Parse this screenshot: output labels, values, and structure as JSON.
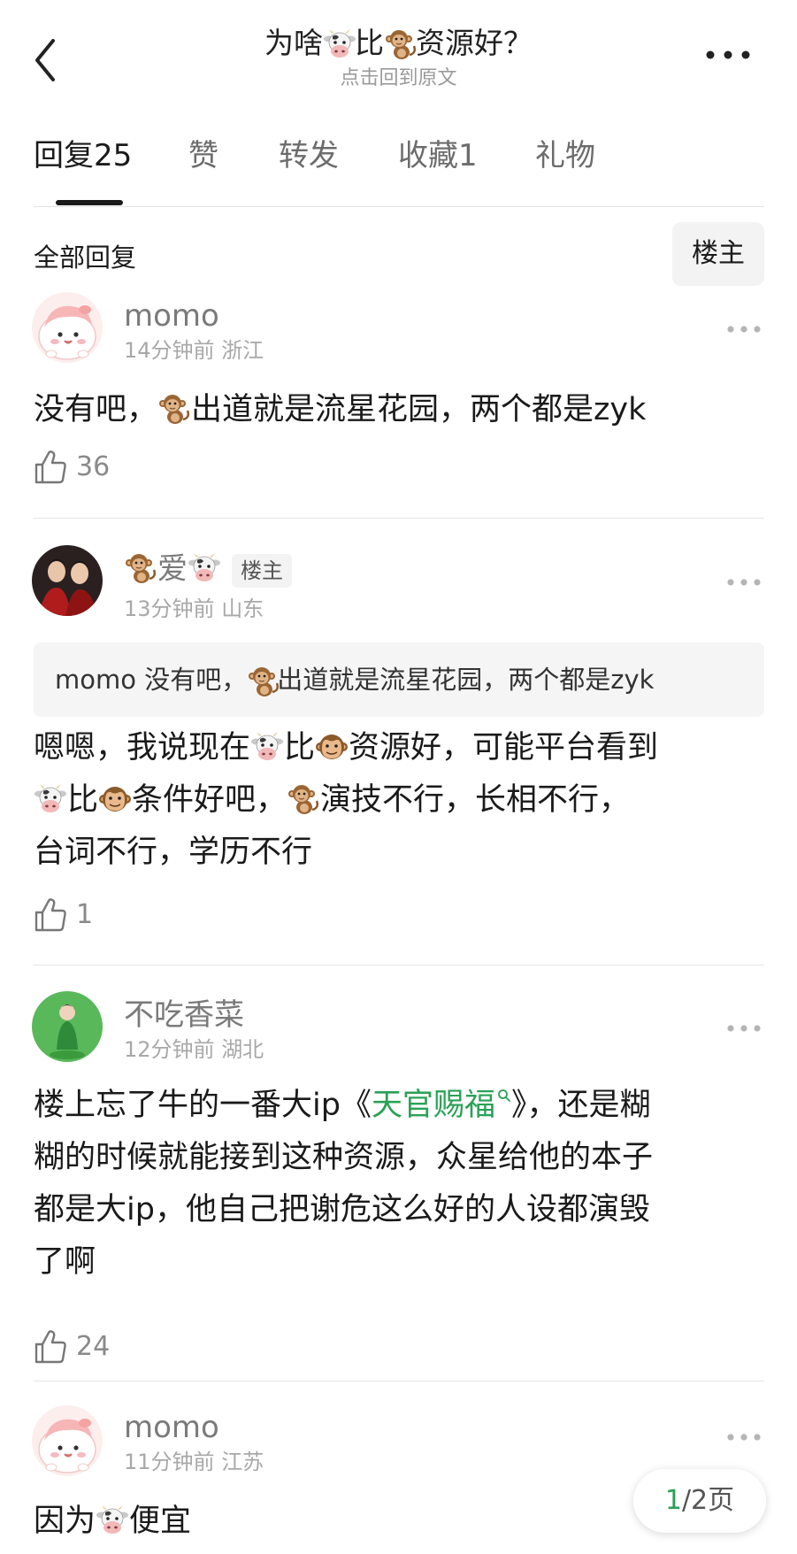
{
  "header": {
    "title_part1": "为啥",
    "title_part2": "比",
    "title_part3": "资源好？",
    "subtitle": "点击回到原文"
  },
  "tabs": [
    {
      "label": "回复",
      "count": "25"
    },
    {
      "label": "赞",
      "count": ""
    },
    {
      "label": "转发",
      "count": ""
    },
    {
      "label": "收藏",
      "count": "1"
    },
    {
      "label": "礼物",
      "count": ""
    }
  ],
  "section": {
    "title": "全部回复",
    "owner_filter": "楼主"
  },
  "comments": [
    {
      "username": "momo",
      "time": "14分钟前",
      "location": "浙江",
      "text_a": "没有吧，",
      "text_b": "出道就是流星花园，两个都是zyk",
      "likes": "36"
    },
    {
      "username_text": "爱",
      "badge": "楼主",
      "time": "13分钟前",
      "location": "山东",
      "quote_user": "momo",
      "quote_a": "没有吧，",
      "quote_b": "出道就是流星花园，两个都是zyk",
      "text_1": "嗯嗯，我说现在",
      "text_2": "比",
      "text_3": "资源好，可能平台看到",
      "text_4": "比",
      "text_5": "条件好吧，",
      "text_6": "演技不行，长相不行，",
      "text_7": "台词不行，学历不行",
      "likes": "1"
    },
    {
      "username": "不吃香菜",
      "time": "12分钟前",
      "location": "湖北",
      "text_1": "楼上忘了牛的一番大ip《",
      "link": "天官赐福",
      "text_2": "》，还是糊",
      "text_3": "糊的时候就能接到这种资源，众星给他的本子",
      "text_4": "都是大ip，他自己把谢危这么好的人设都演毁",
      "text_5": "了啊",
      "likes": "24"
    },
    {
      "username": "momo",
      "time": "11分钟前",
      "location": "江苏",
      "text_1": "因为",
      "text_2": "便宜"
    }
  ],
  "pager": {
    "current": "1",
    "total": "/2页"
  },
  "icons": [
    "back-arrow-icon",
    "more-icon",
    "cow-emoji",
    "monkey-emoji",
    "monkey-face-emoji",
    "thumb-up-icon",
    "search-icon"
  ]
}
